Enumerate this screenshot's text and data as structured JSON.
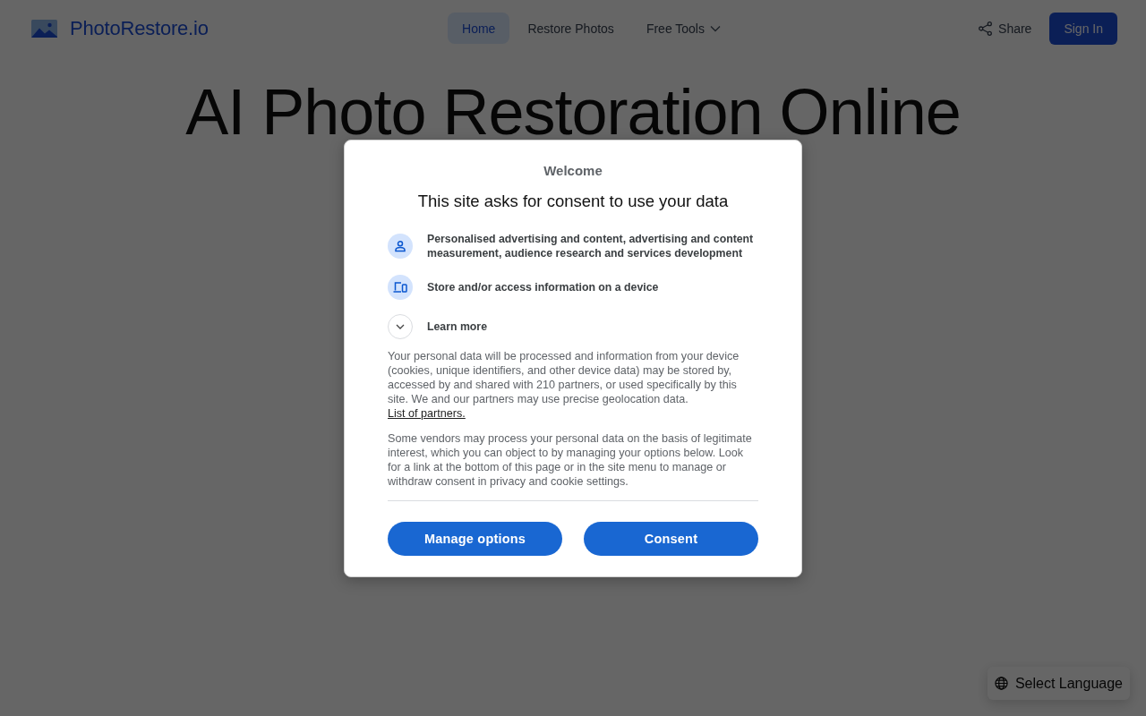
{
  "header": {
    "logo": "PhotoRestore.io",
    "nav": [
      {
        "label": "Home",
        "kind": "link",
        "selected": true
      },
      {
        "label": "Restore Photos",
        "kind": "link",
        "selected": false
      },
      {
        "label": "Free Tools",
        "kind": "menu",
        "selected": false
      }
    ],
    "share": "Share",
    "sign_in": "Sign In"
  },
  "hero": {
    "title": "AI Photo Restoration Online"
  },
  "language_button": "Select Language",
  "consent_dialog": {
    "welcome": "Welcome",
    "title": "This site asks for consent to use your data",
    "purposes": [
      {
        "kind": "person",
        "text": "Personalised advertising and content, advertising and content measurement, audience research and services development"
      },
      {
        "kind": "devices",
        "text": "Store and/or access information on a device"
      }
    ],
    "learn_more": {
      "label": "Learn more",
      "expanded": false
    },
    "paragraphs": [
      {
        "text": "Your personal data will be processed and information from your device (cookies, unique identifiers, and other device data) may be stored by, accessed by and shared with 210 partners, or used specifically by this site. We and our partners may use precise geolocation data.",
        "link": "List of partners."
      },
      {
        "text": "Some vendors may process your personal data on the basis of legitimate interest, which you can object to by managing your options below. Look for a link at the bottom of this page or in the site menu to manage or withdraw consent in privacy and cookie settings."
      }
    ],
    "buttons": [
      "Manage options",
      "Consent"
    ]
  }
}
